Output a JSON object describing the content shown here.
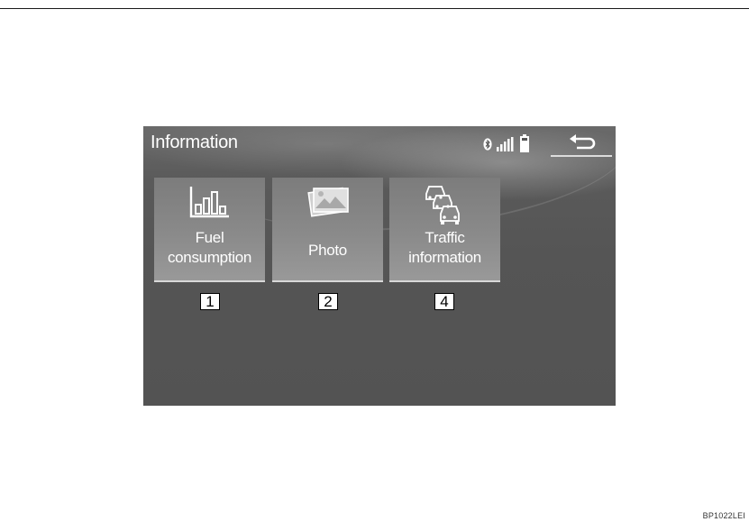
{
  "screen": {
    "title": "Information",
    "status_icons": [
      "bluetooth-icon",
      "signal-strength-icon",
      "battery-icon"
    ],
    "back_button_icon": "back-arrow-icon"
  },
  "tiles": [
    {
      "label_lines": [
        "Fuel",
        "consumption"
      ],
      "icon": "bar-chart-icon",
      "callout": "1"
    },
    {
      "label_lines": [
        "Photo"
      ],
      "icon": "photo-icon",
      "callout": "2"
    },
    {
      "label_lines": [
        "Traffic",
        "information"
      ],
      "icon": "traffic-cars-icon",
      "callout": "4"
    }
  ],
  "figure_code": "BP1022LEI",
  "colors": {
    "screen_background": "#555555",
    "tile_background": "#8a8a8a",
    "text": "#ffffff"
  }
}
